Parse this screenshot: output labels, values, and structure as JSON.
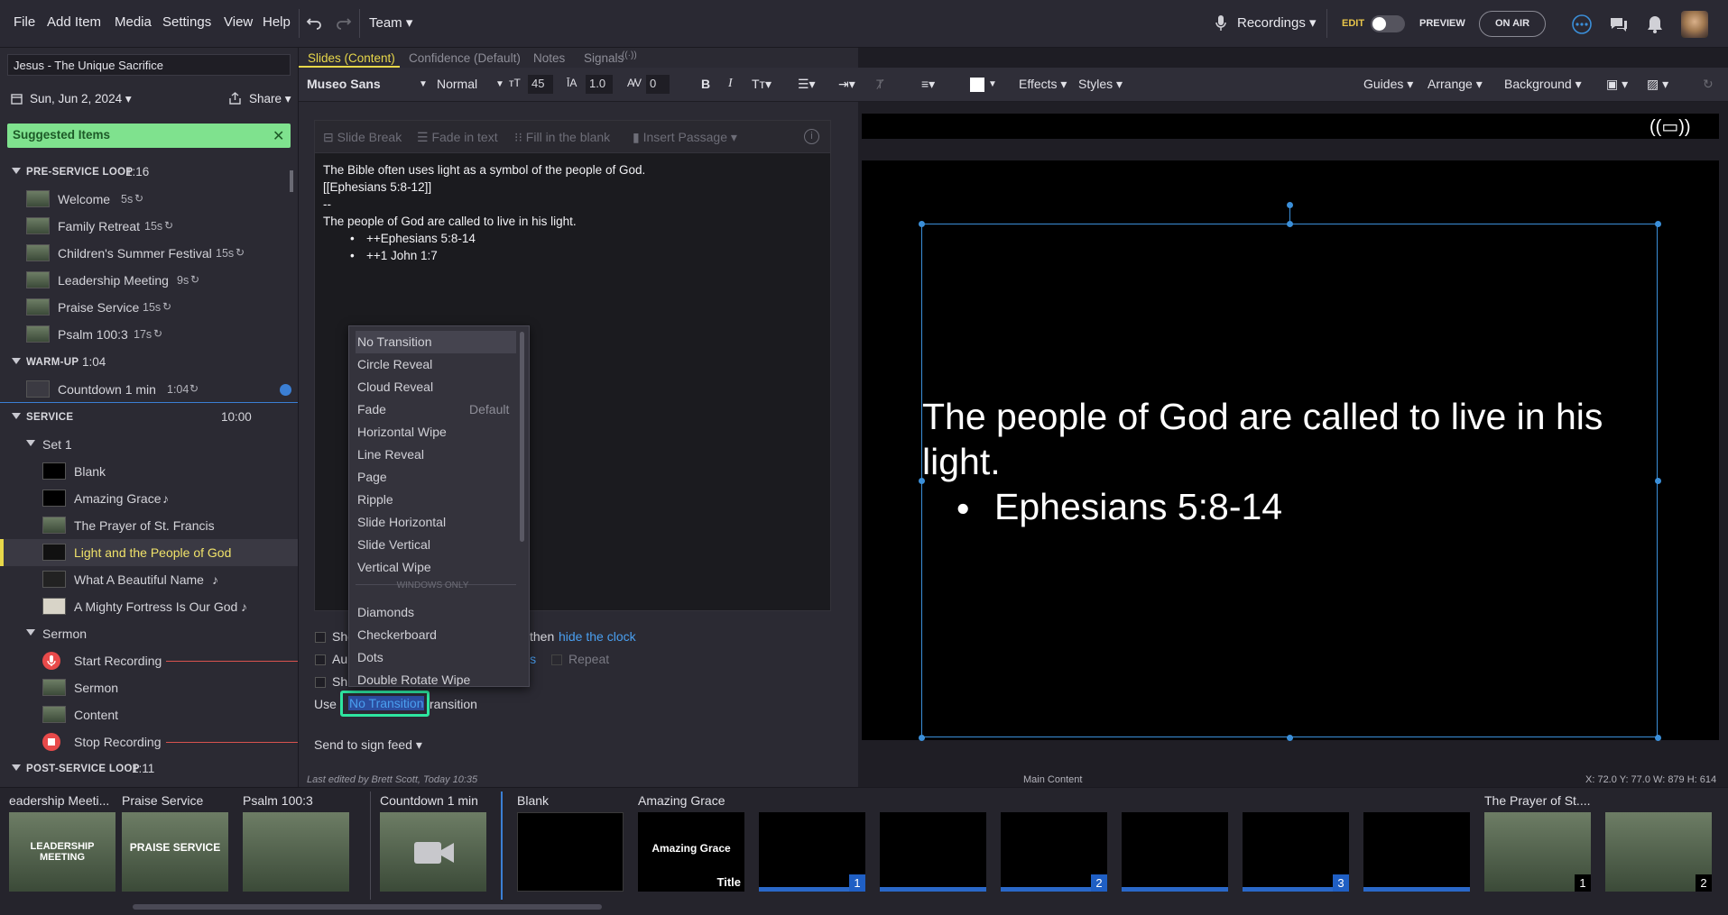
{
  "menubar": {
    "items": [
      "File",
      "Add Item",
      "Media",
      "Settings",
      "View",
      "Help"
    ],
    "team": "Team",
    "recordings": "Recordings",
    "edit": "EDIT",
    "preview": "PREVIEW",
    "on_air": "ON AIR"
  },
  "plan": {
    "title": "Jesus - The Unique Sacrifice",
    "date": "Sun, Jun 2, 2024",
    "share": "Share",
    "suggested": "Suggested Items"
  },
  "sections": {
    "pre_service": {
      "label": "PRE-SERVICE LOOP",
      "duration": "1:16",
      "items": [
        {
          "label": "Welcome",
          "dur": "5s"
        },
        {
          "label": "Family Retreat",
          "dur": "15s"
        },
        {
          "label": "Children's Summer Festival",
          "dur": "15s"
        },
        {
          "label": "Leadership Meeting",
          "dur": "9s"
        },
        {
          "label": "Praise Service",
          "dur": "15s"
        },
        {
          "label": "Psalm 100:3",
          "dur": "17s"
        }
      ]
    },
    "warm_up": {
      "label": "WARM-UP",
      "duration": "1:04",
      "items": [
        {
          "label": "Countdown 1 min",
          "dur": "1:04"
        }
      ]
    },
    "service": {
      "label": "SERVICE",
      "duration": "10:00",
      "set1": "Set 1",
      "set_items": [
        "Blank",
        "Amazing Grace",
        "The Prayer of St. Francis",
        "Light and the People of God",
        "What A Beautiful Name",
        "A Mighty Fortress Is Our God"
      ],
      "sermon": "Sermon",
      "sermon_items": [
        "Start Recording",
        "Sermon",
        "Content",
        "Stop Recording"
      ]
    },
    "post_service": {
      "label": "POST-SERVICE LOOP",
      "duration": "1:11"
    }
  },
  "tabs": [
    "Slides (Content)",
    "Confidence (Default)",
    "Notes",
    "Signals"
  ],
  "format": {
    "font": "Museo Sans",
    "weight": "Normal",
    "size": "45",
    "line_height": "1.0",
    "spacing": "0",
    "effects": "Effects",
    "styles": "Styles",
    "guides": "Guides",
    "arrange": "Arrange",
    "background": "Background"
  },
  "editor_toolbar": [
    "Slide Break",
    "Fade in text",
    "Fill in the blank",
    "Insert Passage"
  ],
  "editor_text": [
    "The Bible often uses light as a symbol of the people of God.",
    "[[Ephesians 5:8-12]]",
    "--",
    "The people of God are called to live in his light.",
    "++Ephesians 5:8-14",
    "++1 John 1:7"
  ],
  "dropdown": {
    "items": [
      "No Transition",
      "Circle Reveal",
      "Cloud Reveal",
      "Fade",
      "Horizontal Wipe",
      "Line Reveal",
      "Page",
      "Ripple",
      "Slide Horizontal",
      "Slide Vertical",
      "Vertical Wipe"
    ],
    "default_tag": "Default",
    "windows_only": "WINDOWS ONLY",
    "win_items": [
      "Diamonds",
      "Checkerboard",
      "Dots",
      "Double Rotate Wipe"
    ]
  },
  "options": {
    "row1_prefix": "Sho",
    "row1_suffix": "then",
    "hide_clock": "hide the clock",
    "row2_prefix": "Au",
    "row2_link": "ls",
    "repeat": "Repeat",
    "row3_prefix": "Sh",
    "use": "Use",
    "transition_value": "No Transition",
    "transition_suffix": "ransition",
    "sign_feed": "Send to sign feed"
  },
  "slide": {
    "line1": "The people of God are called to live in his light.",
    "bullet": "Ephesians 5:8-14"
  },
  "status": {
    "last_edited": "Last edited by Brett Scott, Today 10:35",
    "main_content": "Main Content",
    "coords": "X: 72.0  Y: 77.0   W: 879  H: 614"
  },
  "filmstrip": {
    "groups": [
      "eadership Meeti...",
      "Praise Service",
      "Psalm 100:3",
      "Countdown 1 min",
      "Blank",
      "Amazing Grace",
      "The Prayer of St...."
    ],
    "leadership_thumb": "LEADERSHIP MEETING",
    "praise_thumb": "PRAISE SERVICE",
    "amazing_grace_thumb": "Amazing Grace",
    "title_tag": "Title",
    "badges": [
      "1",
      "2",
      "3",
      "1",
      "2"
    ]
  }
}
